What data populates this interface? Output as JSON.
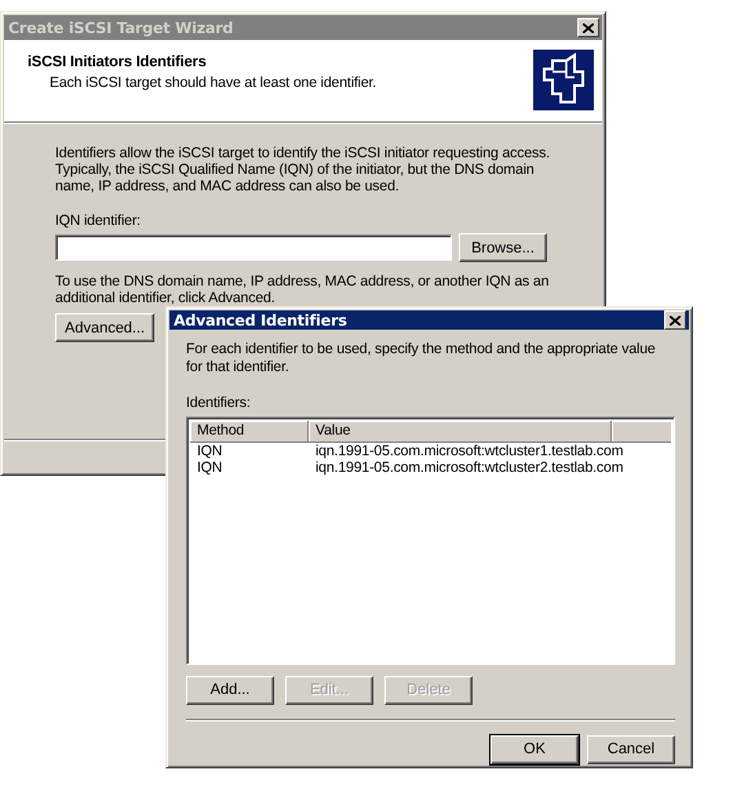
{
  "wizard": {
    "title": "Create iSCSI Target Wizard",
    "active": false,
    "header": {
      "title": "iSCSI Initiators Identifiers",
      "subtitle": "Each iSCSI target should have at least one identifier."
    },
    "intro": "Identifiers allow the iSCSI target to identify the iSCSI initiator requesting access. Typically, the iSCSI Qualified Name (IQN) of the initiator, but the DNS domain name, IP address, and MAC address can also be used.",
    "iqn_label": "IQN identifier:",
    "browse_button": "Browse...",
    "advanced_hint": "To use the DNS domain name, IP address, MAC address, or another IQN as an additional identifier, click Advanced.",
    "advanced_button": "Advanced..."
  },
  "dialog": {
    "title": "Advanced Identifiers",
    "active": true,
    "instructions": "For each identifier to be used, specify the method and the appropriate value for that identifier.",
    "list_label": "Identifiers:",
    "columns": [
      "Method",
      "Value"
    ],
    "rows": [
      {
        "method": "IQN",
        "value": "iqn.1991-05.com.microsoft:wtcluster1.testlab.com",
        "selected": false
      },
      {
        "method": "IQN",
        "value": "iqn.1991-05.com.microsoft:wtcluster2.testlab.com",
        "selected": false
      }
    ],
    "list_buttons": [
      {
        "label": "Add...",
        "disabled": false
      },
      {
        "label": "Edit...",
        "disabled": true
      },
      {
        "label": "Delete",
        "disabled": true
      }
    ],
    "footer_buttons": [
      {
        "label": "OK",
        "default": true
      },
      {
        "label": "Cancel",
        "default": false
      }
    ]
  }
}
